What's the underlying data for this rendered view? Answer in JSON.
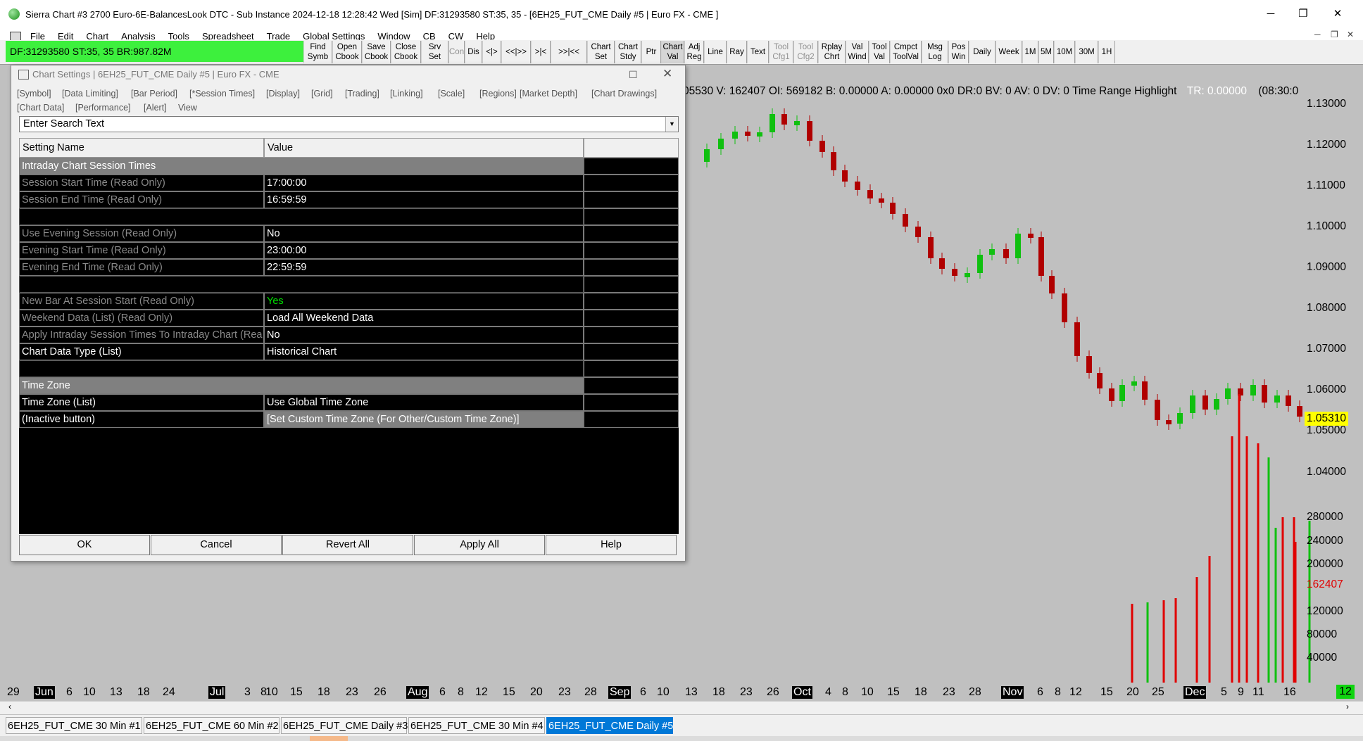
{
  "window": {
    "title": "Sierra Chart #3 2700 Euro-6E-BalancesLook DTC - Sub Instance 2024-12-18  12:28:42 Wed [Sim] DF:31293580  ST:35, 35 - [6EH25_FUT_CME  Daily #5 | Euro FX - CME ]",
    "minimize": "─",
    "restore": "❐",
    "close": "✕"
  },
  "menu": [
    "File",
    "Edit",
    "Chart",
    "Analysis",
    "Tools",
    "Spreadsheet",
    "Trade",
    "Global Settings",
    "Window",
    "CB",
    "CW",
    "Help"
  ],
  "status_bar": {
    "text": "DF:31293580  ST:35, 35  BR:987.82M",
    "color": "#3df03d"
  },
  "toolbar": [
    {
      "label": "Find\nSymb"
    },
    {
      "label": "Open\nCbook"
    },
    {
      "label": "Save\nCbook"
    },
    {
      "label": "Close\nCbook"
    },
    {
      "label": "Srv\nSet"
    },
    {
      "label": "Con"
    },
    {
      "label": "Dis"
    },
    {
      "label": "<|>"
    },
    {
      "label": "<<|>>"
    },
    {
      "label": ">|<"
    },
    {
      "label": ">>|<<"
    },
    {
      "label": "Chart\nSet"
    },
    {
      "label": "Chart\nStdy"
    },
    {
      "label": "Ptr"
    },
    {
      "label": "Chart\nVal"
    },
    {
      "label": "Adj\nReg"
    },
    {
      "label": "Line"
    },
    {
      "label": "Ray"
    },
    {
      "label": "Text"
    },
    {
      "label": "Tool\nCfg1"
    },
    {
      "label": "Tool\nCfg2"
    },
    {
      "label": "Rplay\nChrt"
    },
    {
      "label": "Val\nWind"
    },
    {
      "label": "Tool\nVal"
    },
    {
      "label": "Cmpct\nToolVal"
    },
    {
      "label": "Msg\nLog"
    },
    {
      "label": "Pos\nWin"
    },
    {
      "label": "Daily"
    },
    {
      "label": "Week"
    },
    {
      "label": "1M"
    },
    {
      "label": "5M"
    },
    {
      "label": "10M"
    },
    {
      "label": "30M"
    },
    {
      "label": "1H"
    }
  ],
  "chart": {
    "info_line": "05530 V: 162407  OI: 569182  B: 0.00000  A: 0.00000  0x0  DR:0  BV: 0  AV: 0  DV: 0  Time Range Highlight",
    "tr_text": "TR: 0.00000",
    "time_text": "(08:30:0",
    "price_labels": [
      "1.13000",
      "1.12000",
      "1.11000",
      "1.10000",
      "1.09000",
      "1.08000",
      "1.07000",
      "1.06000",
      "1.05000",
      "1.04000"
    ],
    "last_price": "1.05310",
    "volume_labels": [
      "280000",
      "240000",
      "200000",
      "120000",
      "80000",
      "40000"
    ],
    "last_volume": "162407",
    "x_labels": [
      {
        "t": "29",
        "m": false
      },
      {
        "t": "Jun",
        "m": true
      },
      {
        "t": "6",
        "m": false
      },
      {
        "t": "10",
        "m": false
      },
      {
        "t": "13",
        "m": false
      },
      {
        "t": "18",
        "m": false
      },
      {
        "t": "24",
        "m": false
      },
      {
        "t": "Jul",
        "m": true
      },
      {
        "t": "3",
        "m": false
      },
      {
        "t": "8",
        "m": false
      },
      {
        "t": "10",
        "m": false
      },
      {
        "t": "15",
        "m": false
      },
      {
        "t": "18",
        "m": false
      },
      {
        "t": "23",
        "m": false
      },
      {
        "t": "26",
        "m": false
      },
      {
        "t": "Aug",
        "m": true
      },
      {
        "t": "6",
        "m": false
      },
      {
        "t": "8",
        "m": false
      },
      {
        "t": "12",
        "m": false
      },
      {
        "t": "15",
        "m": false
      },
      {
        "t": "20",
        "m": false
      },
      {
        "t": "23",
        "m": false
      },
      {
        "t": "28",
        "m": false
      },
      {
        "t": "Sep",
        "m": true
      },
      {
        "t": "6",
        "m": false
      },
      {
        "t": "10",
        "m": false
      },
      {
        "t": "13",
        "m": false
      },
      {
        "t": "18",
        "m": false
      },
      {
        "t": "23",
        "m": false
      },
      {
        "t": "26",
        "m": false
      },
      {
        "t": "Oct",
        "m": true
      },
      {
        "t": "4",
        "m": false
      },
      {
        "t": "8",
        "m": false
      },
      {
        "t": "10",
        "m": false
      },
      {
        "t": "15",
        "m": false
      },
      {
        "t": "18",
        "m": false
      },
      {
        "t": "23",
        "m": false
      },
      {
        "t": "28",
        "m": false
      },
      {
        "t": "Nov",
        "m": true
      },
      {
        "t": "6",
        "m": false
      },
      {
        "t": "8",
        "m": false
      },
      {
        "t": "12",
        "m": false
      },
      {
        "t": "15",
        "m": false
      },
      {
        "t": "20",
        "m": false
      },
      {
        "t": "25",
        "m": false
      },
      {
        "t": "Dec",
        "m": true
      },
      {
        "t": "5",
        "m": false
      },
      {
        "t": "9",
        "m": false
      },
      {
        "t": "11",
        "m": false
      },
      {
        "t": "16",
        "m": false
      }
    ],
    "x_right": "12"
  },
  "tabs": [
    {
      "label": "6EH25_FUT_CME  30 Min  #1",
      "active": false
    },
    {
      "label": "6EH25_FUT_CME  60 Min  #2",
      "active": false
    },
    {
      "label": "6EH25_FUT_CME  Daily #3",
      "active": false
    },
    {
      "label": "6EH25_FUT_CME  30 Min  #4",
      "active": false
    },
    {
      "label": "6EH25_FUT_CME  Daily #5",
      "active": true
    }
  ],
  "dialog": {
    "title": "Chart Settings | 6EH25_FUT_CME  Daily #5 | Euro FX - CME",
    "maximize": "☐",
    "close": "✕",
    "tabs_row1": [
      "[Symbol]",
      "[Data Limiting]",
      "[Bar Period]",
      "[*Session Times]",
      "[Display]",
      "[Grid]",
      "[Trading]",
      "[Linking]",
      "[Scale]",
      "[Regions]",
      "[Market Depth]",
      "[Chart Drawings]"
    ],
    "tabs_row2": [
      "[Chart Data]",
      "[Performance]",
      "[Alert]",
      "View"
    ],
    "search_placeholder": "Enter Search Text",
    "dropdown_arrow": "▼",
    "header": {
      "name": "Setting Name",
      "value": "Value"
    },
    "rows": [
      {
        "type": "section",
        "name": "Intraday Chart Session Times"
      },
      {
        "type": "setting",
        "name": "Session Start Time (Read Only)",
        "value": "17:00:00",
        "ro": true
      },
      {
        "type": "setting",
        "name": "Session End Time (Read Only)",
        "value": "16:59:59",
        "ro": true
      },
      {
        "type": "blank"
      },
      {
        "type": "setting",
        "name": "Use Evening Session (Read Only)",
        "value": "No",
        "ro": true
      },
      {
        "type": "setting",
        "name": "Evening Start Time (Read Only)",
        "value": "23:00:00",
        "ro": true
      },
      {
        "type": "setting",
        "name": "Evening End Time (Read Only)",
        "value": "22:59:59",
        "ro": true
      },
      {
        "type": "blank"
      },
      {
        "type": "setting",
        "name": "New Bar At Session Start (Read Only)",
        "value": "Yes",
        "ro": true,
        "green": true
      },
      {
        "type": "setting",
        "name": "Weekend Data (List) (Read Only)",
        "value": "Load All Weekend Data",
        "ro": true
      },
      {
        "type": "setting",
        "name": "Apply Intraday Session Times To Intraday Chart (Rea",
        "value": "No",
        "ro": true
      },
      {
        "type": "setting",
        "name": "Chart Data Type (List)",
        "value": "Historical Chart",
        "ro": false
      },
      {
        "type": "blank"
      },
      {
        "type": "section",
        "name": "Time Zone"
      },
      {
        "type": "setting",
        "name": "Time Zone (List)",
        "value": "Use Global Time Zone",
        "ro": false
      },
      {
        "type": "inactive",
        "name": " (Inactive button)",
        "value": "[Set Custom Time Zone (For Other/Custom Time Zone)]"
      }
    ],
    "buttons": [
      "OK",
      "Cancel",
      "Revert All",
      "Apply All",
      "Help"
    ]
  }
}
